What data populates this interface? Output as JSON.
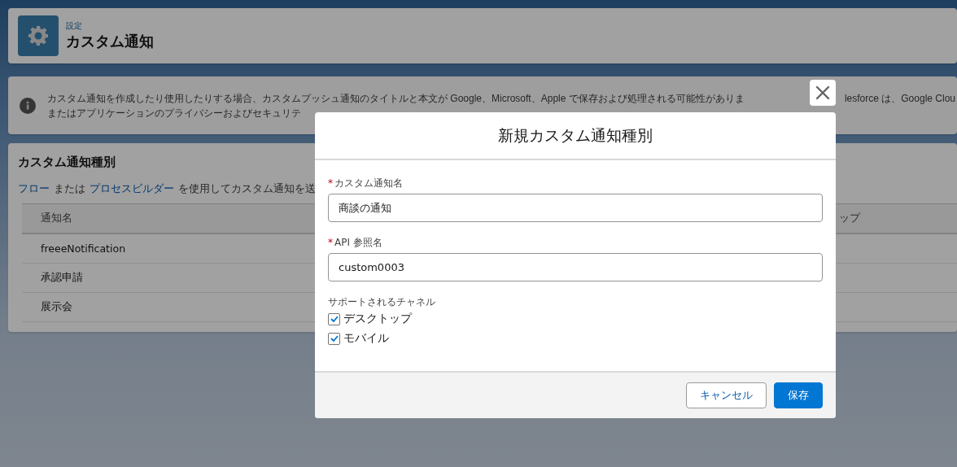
{
  "page_header": {
    "breadcrumb": "設定",
    "title": "カスタム通知"
  },
  "info_banner": {
    "line_1": "カスタム通知を作成したり使用したりする場合、カスタムプッシュ通知のタイトルと本文が Google、Microsoft、Apple で保存および処理される可能性がありま",
    "line_1_tail": "lesforce は、Google Clou",
    "line_2": "またはアプリケーションのプライバシーおよびセキュリテ"
  },
  "section": {
    "title": "カスタム通知種別",
    "intro": [
      {
        "kind": "link",
        "text": "フロー"
      },
      {
        "kind": "text",
        "text": "または"
      },
      {
        "kind": "link",
        "text": "プロセスビルダー"
      },
      {
        "kind": "text",
        "text": "を使用してカスタム通知を送"
      }
    ],
    "table": {
      "columns": [
        "通知名",
        "ップ"
      ],
      "rows": [
        [
          "freeeNotification"
        ],
        [
          "承認申請"
        ],
        [
          "展示会"
        ]
      ]
    }
  },
  "modal": {
    "title": "新規カスタム通知種別",
    "fields": [
      {
        "required_mark": "*",
        "label": "カスタム通知名",
        "value": "商談の通知"
      },
      {
        "required_mark": "*",
        "label": "API 参照名",
        "value": "custom0003"
      }
    ],
    "channels": {
      "label": "サポートされるチャネル",
      "options": [
        {
          "label": "デスクトップ",
          "checked": true
        },
        {
          "label": "モバイル",
          "checked": true
        }
      ]
    },
    "buttons": [
      {
        "kind": "neutral",
        "label": "キャンセル"
      },
      {
        "kind": "brand",
        "label": "保存"
      }
    ]
  }
}
